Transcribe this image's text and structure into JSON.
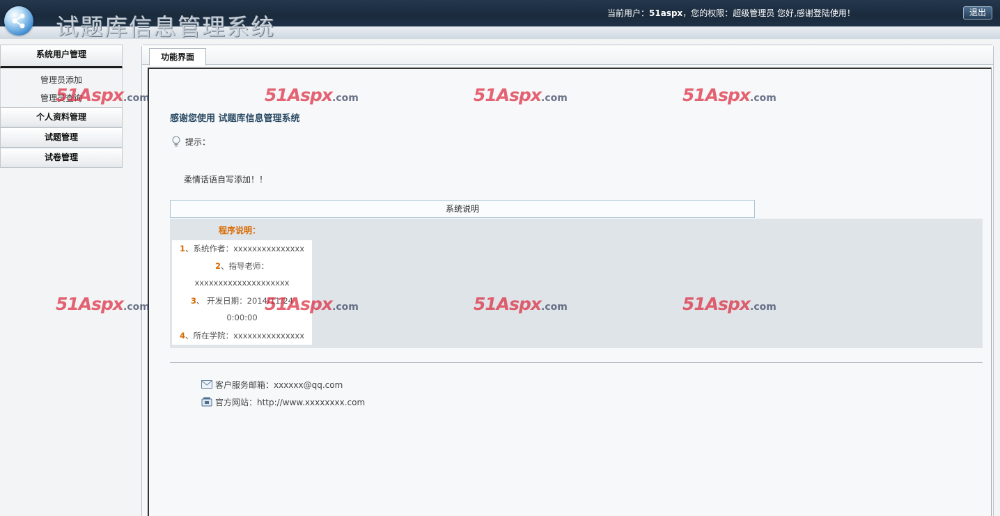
{
  "header": {
    "app_title": "试题库信息管理系统",
    "user_prefix": "当前用户：",
    "username": "51aspx",
    "user_suffix": "，您的权限：超级管理员 您好,感谢登陆使用！",
    "logout_label": "退出"
  },
  "sidebar": {
    "groups": [
      {
        "label": "系统用户管理",
        "items": [
          "管理员添加",
          "管理员查询"
        ]
      },
      {
        "label": "个人资料管理"
      },
      {
        "label": "试题管理"
      },
      {
        "label": "试卷管理"
      }
    ]
  },
  "main": {
    "tab_label": "功能界面",
    "welcome": "感谢您使用 试题库信息管理系统",
    "tip_label": "提示：",
    "tip_text": "柔情话语自写添加！！",
    "desc_header": "系统说明",
    "program_label": "程序说明：",
    "info": [
      {
        "num": "1",
        "text": "、系统作者：xxxxxxxxxxxxxxx"
      },
      {
        "num": "2",
        "text": "、指导老师："
      },
      {
        "num": "",
        "text": "xxxxxxxxxxxxxxxxxxxx"
      },
      {
        "num": "3",
        "text": "、 开发日期：2014/11/24"
      },
      {
        "num": "",
        "text": "0:00:00"
      },
      {
        "num": "4",
        "text": "、所在学院：xxxxxxxxxxxxxxx"
      }
    ],
    "contact_email": "客户服务邮箱：xxxxxx@qq.com",
    "contact_site": "官方网站：http://www.xxxxxxxx.com"
  },
  "watermark": {
    "text": "51Aspx",
    "suffix": ".com"
  },
  "colors": {
    "accent_orange": "#d96a00",
    "header_dark": "#1b2b3d",
    "watermark_red": "#dc283c"
  }
}
